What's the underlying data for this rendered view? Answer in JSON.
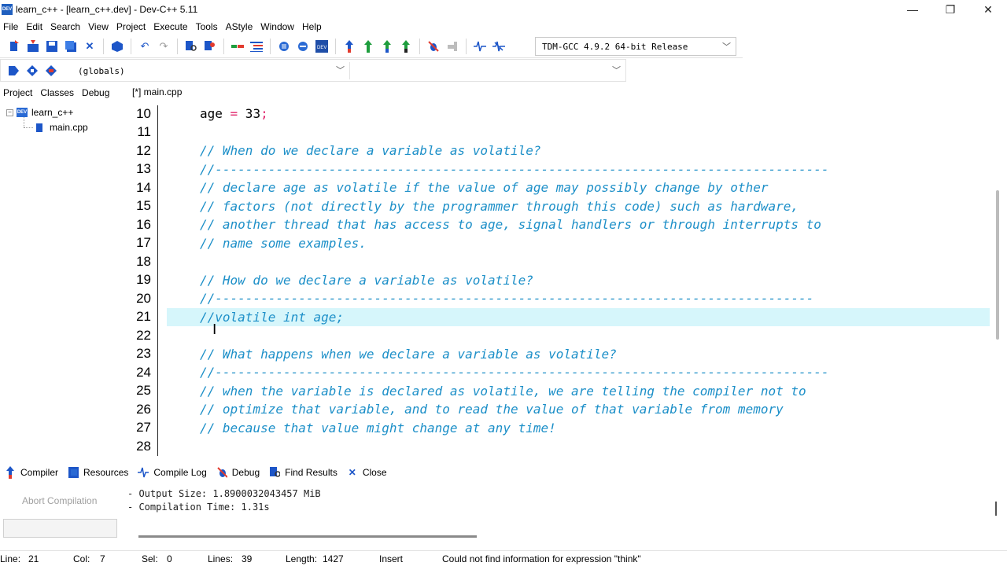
{
  "window": {
    "title": "learn_c++ - [learn_c++.dev] - Dev-C++ 5.11",
    "icon_label": "DEV",
    "minimize": "—",
    "maximize": "❐",
    "close": "✕"
  },
  "menu": [
    "File",
    "Edit",
    "Search",
    "View",
    "Project",
    "Execute",
    "Tools",
    "AStyle",
    "Window",
    "Help"
  ],
  "toolbar": {
    "compiler": "TDM-GCC 4.9.2 64-bit Release",
    "scope": "(globals)"
  },
  "left_panel": {
    "tabs": [
      "Project",
      "Classes",
      "Debug"
    ],
    "project_name": "learn_c++",
    "project_icon_label": "DEV",
    "file_name": "main.cpp",
    "expander": "−"
  },
  "editor": {
    "tab_label": "[*] main.cpp",
    "active_line": 21,
    "lines": [
      {
        "n": "10",
        "kind": "stmt",
        "a": "age ",
        "op": "=",
        "b": " 33",
        "semi": ";"
      },
      {
        "n": "11",
        "kind": "blank",
        "text": ""
      },
      {
        "n": "12",
        "kind": "comment",
        "text": "// When do we declare a variable as volatile?"
      },
      {
        "n": "13",
        "kind": "comment",
        "text": "//---------------------------------------------------------------------------------"
      },
      {
        "n": "14",
        "kind": "comment",
        "text": "// declare age as volatile if the value of age may possibly change by other"
      },
      {
        "n": "15",
        "kind": "comment",
        "text": "// factors (not directly by the programmer through this code) such as hardware,"
      },
      {
        "n": "16",
        "kind": "comment",
        "text": "// another thread that has access to age, signal handlers or through interrupts to"
      },
      {
        "n": "17",
        "kind": "comment",
        "text": "// name some examples."
      },
      {
        "n": "18",
        "kind": "blank",
        "text": ""
      },
      {
        "n": "19",
        "kind": "comment",
        "text": "// How do we declare a variable as volatile?"
      },
      {
        "n": "20",
        "kind": "comment",
        "text": "//-------------------------------------------------------------------------------"
      },
      {
        "n": "21",
        "kind": "comment",
        "text": "//volatile int age;"
      },
      {
        "n": "22",
        "kind": "blank",
        "text": ""
      },
      {
        "n": "23",
        "kind": "comment",
        "text": "// What happens when we declare a variable as volatile?"
      },
      {
        "n": "24",
        "kind": "comment",
        "text": "//---------------------------------------------------------------------------------"
      },
      {
        "n": "25",
        "kind": "comment",
        "text": "// when the variable is declared as volatile, we are telling the compiler not to"
      },
      {
        "n": "26",
        "kind": "comment",
        "text": "// optimize that variable, and to read the value of that variable from memory"
      },
      {
        "n": "27",
        "kind": "comment",
        "text": "// because that value might change at any time!"
      },
      {
        "n": "28",
        "kind": "blank",
        "text": ""
      }
    ]
  },
  "bottom_panel": {
    "tabs": [
      {
        "label": "Compiler",
        "icon": "compiler-icon"
      },
      {
        "label": "Resources",
        "icon": "resources-icon"
      },
      {
        "label": "Compile Log",
        "icon": "compile-log-icon"
      },
      {
        "label": "Debug",
        "icon": "debug-icon"
      },
      {
        "label": "Find Results",
        "icon": "find-results-icon"
      },
      {
        "label": "Close",
        "icon": "close-icon"
      }
    ],
    "abort_label": "Abort Compilation",
    "log_lines": [
      "- Output Size: 1.8900032043457 MiB",
      "- Compilation Time: 1.31s"
    ]
  },
  "status": {
    "line_label": "Line:",
    "line_value": "21",
    "col_label": "Col:",
    "col_value": "7",
    "sel_label": "Sel:",
    "sel_value": "0",
    "lines_label": "Lines:",
    "lines_value": "39",
    "length_label": "Length:",
    "length_value": "1427",
    "mode": "Insert",
    "message": "Could not find information for expression \"think\""
  },
  "colors": {
    "comment": "#1c8fc8",
    "operator": "#e0246b",
    "active_line": "#d6f6fb"
  }
}
